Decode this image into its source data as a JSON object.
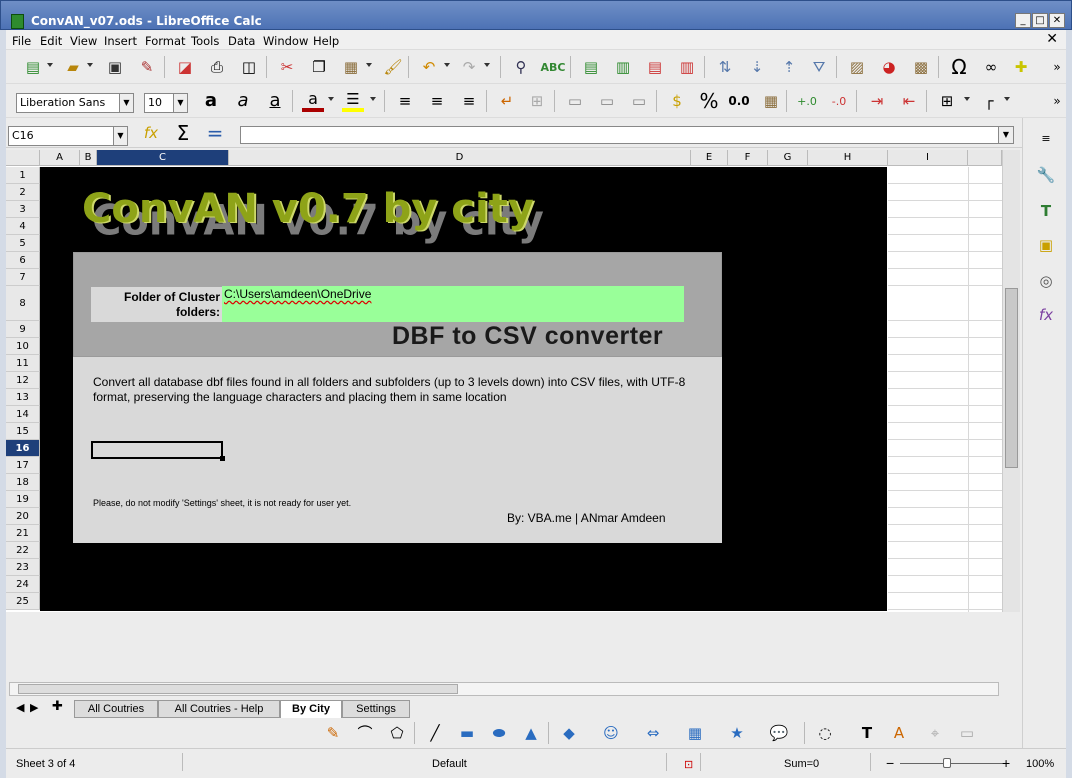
{
  "window": {
    "title": "ConvAN_v07.ods - LibreOffice Calc"
  },
  "menu": [
    "File",
    "Edit",
    "View",
    "Insert",
    "Format",
    "Tools",
    "Data",
    "Window",
    "Help"
  ],
  "toolbar": {
    "font_name": "Liberation Sans",
    "font_size": "10"
  },
  "formula_bar": {
    "cell_ref": "C16",
    "content": ""
  },
  "columns": [
    "A",
    "B",
    "C",
    "D",
    "E",
    "F",
    "G",
    "H",
    "I"
  ],
  "rows": [
    "1",
    "2",
    "3",
    "4",
    "5",
    "6",
    "7",
    "8",
    "9",
    "10",
    "11",
    "12",
    "13",
    "14",
    "15",
    "16",
    "17",
    "18",
    "19",
    "20",
    "21",
    "22",
    "23",
    "24",
    "25"
  ],
  "selected_cell": "C16",
  "sheet": {
    "title": "ConvAN v0.7 by city",
    "folder_label": "Folder of Cluster folders:",
    "folder_value": "C:\\Users\\amdeen\\OneDrive",
    "subtitle": "DBF to CSV converter",
    "description": "Convert all database dbf files found in all folders and subfolders (up to 3 levels down) into CSV files, with UTF-8 format, preserving the language characters and placing them in same location",
    "note": "Please, do not modify 'Settings' sheet, it is not ready for user yet.",
    "byline": "By: VBA.me | ANmar Amdeen"
  },
  "tabs": [
    {
      "label": "All Coutries",
      "active": false
    },
    {
      "label": "All Coutries - Help",
      "active": false
    },
    {
      "label": "By City",
      "active": true
    },
    {
      "label": "Settings",
      "active": false
    }
  ],
  "status": {
    "sheet": "Sheet 3 of 4",
    "style": "Default",
    "sum": "Sum=0",
    "zoom": "100%"
  },
  "colors": {
    "panel_gray": "#d9d9d9",
    "input_green": "#99ff99",
    "title_olive": "#8ea318"
  }
}
